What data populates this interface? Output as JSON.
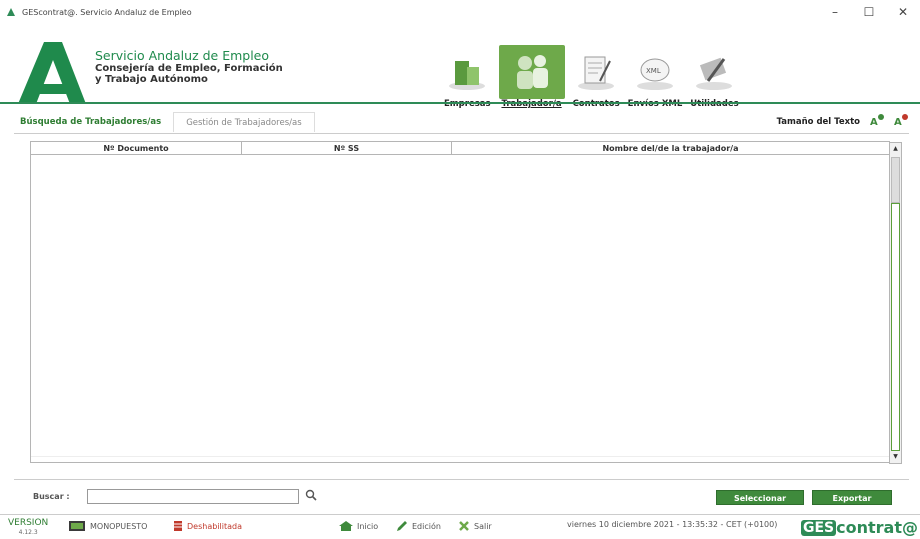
{
  "window": {
    "title": "GEScontrat@. Servicio Andaluz de Empleo",
    "controls": [
      "–",
      "☐",
      "✕"
    ]
  },
  "org": {
    "line1": "Servicio Andaluz de Empleo",
    "line2": "Consejería de Empleo, Formación",
    "line3": "y Trabajo Autónomo"
  },
  "nav": {
    "items": [
      {
        "label": "Empresas"
      },
      {
        "label": "Trabajador/a"
      },
      {
        "label": "Contratos"
      },
      {
        "label": "Envíos XML"
      },
      {
        "label": "Utilidades"
      }
    ],
    "active_index": 1
  },
  "tabs": {
    "items": [
      {
        "label": "Búsqueda de Trabajadores/as"
      },
      {
        "label": "Gestión de Trabajadores/as"
      }
    ]
  },
  "textsize": {
    "label": "Tamaño del Texto",
    "increase": "A",
    "decrease": "A"
  },
  "table": {
    "columns": [
      {
        "label": "Nº Documento"
      },
      {
        "label": "Nº SS"
      },
      {
        "label": "Nombre del/de la trabajador/a"
      }
    ],
    "rows": []
  },
  "search": {
    "label": "Buscar :",
    "value": "",
    "select_label": "Seleccionar",
    "export_label": "Exportar"
  },
  "status": {
    "version_label": "VERSION",
    "version_number": "4.12.3",
    "mode": "MONOPUESTO",
    "state": "Deshabilitada",
    "home": "Inicio",
    "edit": "Edición",
    "exit": "Salir",
    "datetime": "viernes 10 diciembre 2021 - 13:35:32 - CET (+0100)",
    "brand_prefix": "GES",
    "brand_suffix": "contrat@"
  },
  "colors": {
    "accent": "#2e8b57",
    "button": "#3f8a3c",
    "active_nav": "#6ea94a"
  }
}
